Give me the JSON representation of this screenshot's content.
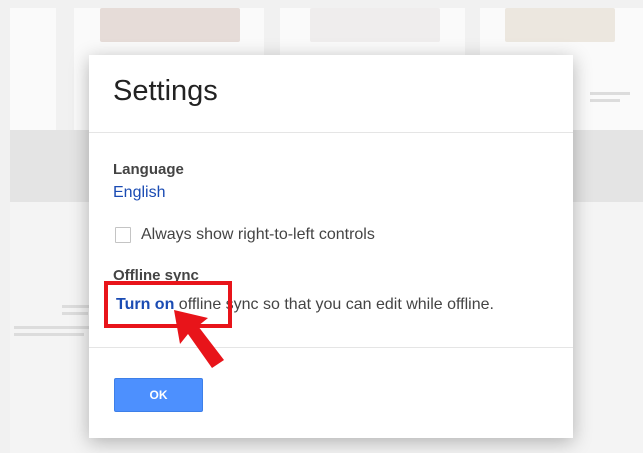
{
  "dialog": {
    "title": "Settings",
    "language_label": "Language",
    "language_value": "English",
    "rtl_checkbox_label": "Always show right-to-left controls",
    "rtl_checked": false,
    "offline_label": "Offline sync",
    "offline_link": "Turn on",
    "offline_rest": " offline sync so that you can edit while offline.",
    "ok_button": "OK"
  },
  "annotation": {
    "highlight_color": "#e8141a",
    "arrow_icon": "red-arrow-icon"
  },
  "colors": {
    "link": "#1a4bb3",
    "primary_button": "#4d90fe"
  }
}
